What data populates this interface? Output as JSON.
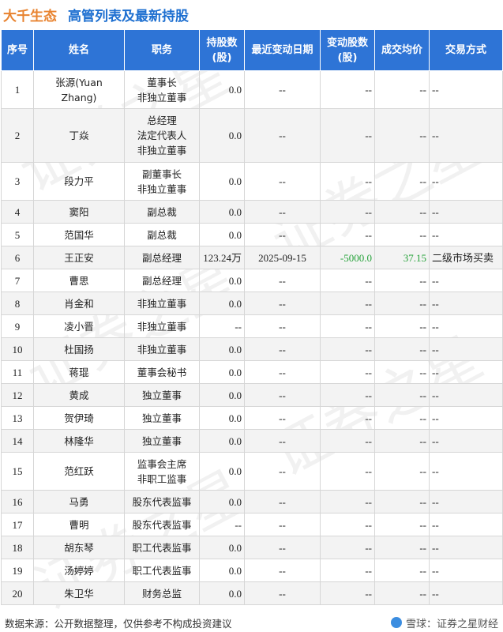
{
  "header": {
    "company": "大千生态",
    "title": "高管列表及最新持股"
  },
  "table": {
    "columns": [
      "序号",
      "姓名",
      "职务",
      "持股数\n(股)",
      "最近变动日期",
      "变动股数\n(股)",
      "成交均价",
      "交易方式"
    ],
    "rows": [
      {
        "no": "1",
        "name": "张源(Yuan Zhang)",
        "role": "董事长\n非独立董事",
        "shares": "0.0",
        "date": "--",
        "change": "--",
        "price": "--",
        "method": "--"
      },
      {
        "no": "2",
        "name": "丁焱",
        "role": "总经理\n法定代表人\n非独立董事",
        "shares": "0.0",
        "date": "--",
        "change": "--",
        "price": "--",
        "method": "--"
      },
      {
        "no": "3",
        "name": "段力平",
        "role": "副董事长\n非独立董事",
        "shares": "0.0",
        "date": "--",
        "change": "--",
        "price": "--",
        "method": "--"
      },
      {
        "no": "4",
        "name": "窦阳",
        "role": "副总裁",
        "shares": "0.0",
        "date": "--",
        "change": "--",
        "price": "--",
        "method": "--"
      },
      {
        "no": "5",
        "name": "范国华",
        "role": "副总裁",
        "shares": "0.0",
        "date": "--",
        "change": "--",
        "price": "--",
        "method": "--"
      },
      {
        "no": "6",
        "name": "王正安",
        "role": "副总经理",
        "shares": "123.24万",
        "date": "2025-09-15",
        "change": "-5000.0",
        "price": "37.15",
        "method": "二级市场买卖"
      },
      {
        "no": "7",
        "name": "曹思",
        "role": "副总经理",
        "shares": "0.0",
        "date": "--",
        "change": "--",
        "price": "--",
        "method": "--"
      },
      {
        "no": "8",
        "name": "肖金和",
        "role": "非独立董事",
        "shares": "0.0",
        "date": "--",
        "change": "--",
        "price": "--",
        "method": "--"
      },
      {
        "no": "9",
        "name": "凌小晋",
        "role": "非独立董事",
        "shares": "--",
        "date": "--",
        "change": "--",
        "price": "--",
        "method": "--"
      },
      {
        "no": "10",
        "name": "杜国扬",
        "role": "非独立董事",
        "shares": "0.0",
        "date": "--",
        "change": "--",
        "price": "--",
        "method": "--"
      },
      {
        "no": "11",
        "name": "蒋琨",
        "role": "董事会秘书",
        "shares": "0.0",
        "date": "--",
        "change": "--",
        "price": "--",
        "method": "--"
      },
      {
        "no": "12",
        "name": "黄成",
        "role": "独立董事",
        "shares": "0.0",
        "date": "--",
        "change": "--",
        "price": "--",
        "method": "--"
      },
      {
        "no": "13",
        "name": "贺伊琦",
        "role": "独立董事",
        "shares": "0.0",
        "date": "--",
        "change": "--",
        "price": "--",
        "method": "--"
      },
      {
        "no": "14",
        "name": "林隆华",
        "role": "独立董事",
        "shares": "0.0",
        "date": "--",
        "change": "--",
        "price": "--",
        "method": "--"
      },
      {
        "no": "15",
        "name": "范红跃",
        "role": "监事会主席\n非职工监事",
        "shares": "0.0",
        "date": "--",
        "change": "--",
        "price": "--",
        "method": "--"
      },
      {
        "no": "16",
        "name": "马勇",
        "role": "股东代表监事",
        "shares": "0.0",
        "date": "--",
        "change": "--",
        "price": "--",
        "method": "--"
      },
      {
        "no": "17",
        "name": "曹明",
        "role": "股东代表监事",
        "shares": "--",
        "date": "--",
        "change": "--",
        "price": "--",
        "method": "--"
      },
      {
        "no": "18",
        "name": "胡东琴",
        "role": "职工代表监事",
        "shares": "0.0",
        "date": "--",
        "change": "--",
        "price": "--",
        "method": "--"
      },
      {
        "no": "19",
        "name": "汤婷婷",
        "role": "职工代表监事",
        "shares": "0.0",
        "date": "--",
        "change": "--",
        "price": "--",
        "method": "--"
      },
      {
        "no": "20",
        "name": "朱卫华",
        "role": "财务总监",
        "shares": "0.0",
        "date": "--",
        "change": "--",
        "price": "--",
        "method": "--"
      }
    ]
  },
  "watermark": {
    "text": "证券之星"
  },
  "footer": {
    "source": "数据来源：公开数据整理，仅供参考不构成投资建议",
    "brand": "雪球：证券之星财经",
    "brand_icon": "snowball-icon"
  },
  "colors": {
    "header_blue": "#2e74d6",
    "company_orange": "#e8832f",
    "title_blue": "#1d6fd0",
    "negative_green": "#27a33b"
  }
}
